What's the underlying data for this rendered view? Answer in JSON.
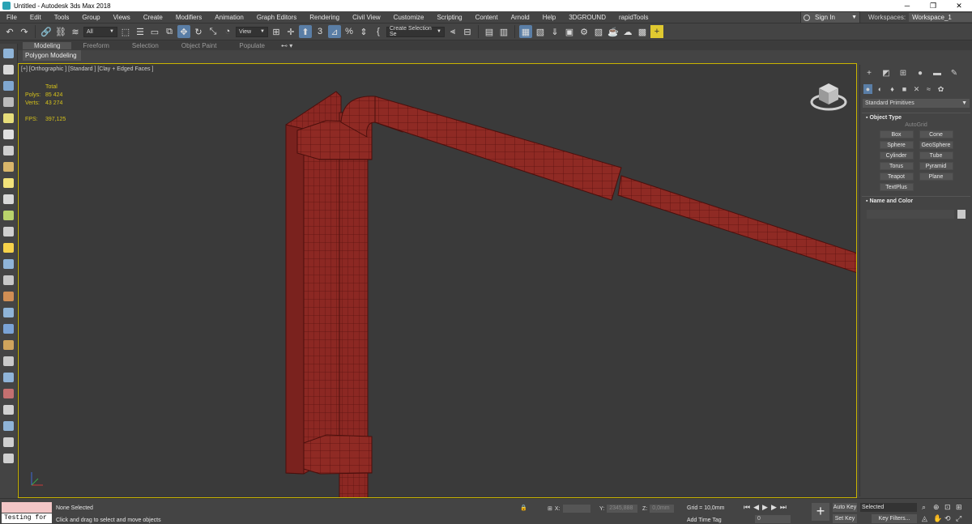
{
  "window": {
    "title": "Untitled - Autodesk 3ds Max 2018",
    "minimize": "─",
    "maximize": "❐",
    "close": "✕"
  },
  "menu": [
    "File",
    "Edit",
    "Tools",
    "Group",
    "Views",
    "Create",
    "Modifiers",
    "Animation",
    "Graph Editors",
    "Rendering",
    "Civil View",
    "Customize",
    "Scripting",
    "Content",
    "Arnold",
    "Help",
    "3DGROUND",
    "rapidTools"
  ],
  "account": {
    "sign_in": "Sign In",
    "workspaces_label": "Workspaces:",
    "workspace_value": "Workspace_1"
  },
  "toolbar": {
    "filter_value": "All",
    "coord_system": "View",
    "selection_set": "Create Selection Se"
  },
  "ribbon": {
    "tabs": [
      "Modeling",
      "Freeform",
      "Selection",
      "Object Paint",
      "Populate"
    ],
    "extra": "⊷ ▾",
    "sub_label": "Polygon Modeling"
  },
  "viewport": {
    "label": "[+] [Orthographic ] [Standard ] [Clay + Edged Faces ]",
    "stats": {
      "header": "Total",
      "polys_label": "Polys:",
      "polys_value": "85 424",
      "verts_label": "Verts:",
      "verts_value": "43 274",
      "fps_label": "FPS:",
      "fps_value": "397,125"
    },
    "object_color": "#8f2a24"
  },
  "command_panel": {
    "category": "Standard Primitives",
    "object_type_title": "Object Type",
    "autogrid": "AutoGrid",
    "primitives": [
      "Box",
      "Cone",
      "Sphere",
      "GeoSphere",
      "Cylinder",
      "Tube",
      "Torus",
      "Pyramid",
      "Teapot",
      "Plane",
      "TextPlus"
    ],
    "name_color_title": "Name and Color"
  },
  "status": {
    "maxscript_output": "Testing for :",
    "selection": "None Selected",
    "prompt": "Click and drag to select and move objects",
    "x_label": "X:",
    "x_value": "",
    "y_label": "Y:",
    "y_value": "2345,888",
    "z_label": "Z:",
    "z_value": "0,0mm",
    "grid": "Grid = 10,0mm",
    "add_time_tag": "Add Time Tag",
    "frame": "0",
    "auto_key": "Auto Key",
    "set_key": "Set Key",
    "selected": "Selected",
    "key_filters": "Key Filters..."
  }
}
